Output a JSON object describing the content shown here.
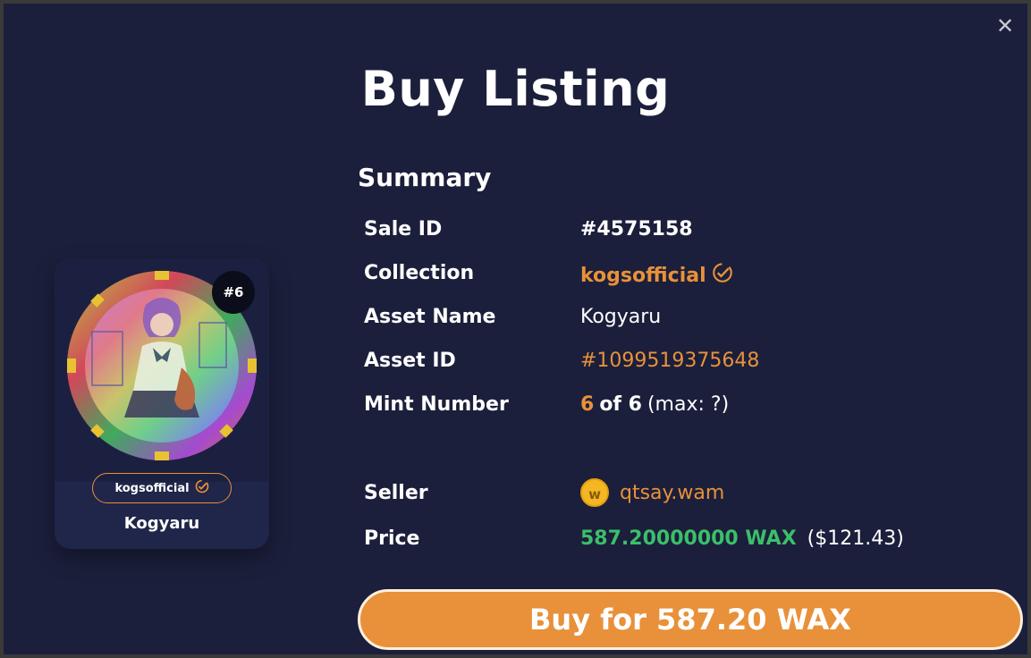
{
  "modal": {
    "title": "Buy Listing",
    "close_icon": "close-icon"
  },
  "card": {
    "mint_badge": "#6",
    "collection": "kogsofficial",
    "name": "Kogyaru"
  },
  "summary": {
    "title": "Summary",
    "sale_id": {
      "label": "Sale ID",
      "value": "#4575158"
    },
    "collection": {
      "label": "Collection",
      "value": "kogsofficial"
    },
    "asset_name": {
      "label": "Asset Name",
      "value": "Kogyaru"
    },
    "asset_id": {
      "label": "Asset ID",
      "value": "#1099519375648"
    },
    "mint_number": {
      "label": "Mint Number",
      "mint": "6",
      "of_text": "of 6",
      "max_text": "(max: ?)"
    },
    "seller": {
      "label": "Seller",
      "value": "qtsay.wam",
      "coin_letter": "w"
    },
    "price": {
      "label": "Price",
      "wax": "587.20000000 WAX",
      "usd": "($121.43)"
    }
  },
  "buy_button": {
    "label": "Buy for 587.20 WAX"
  },
  "colors": {
    "background": "#1b1f3b",
    "accent": "#e8913a",
    "price_green": "#3bbf6a"
  }
}
